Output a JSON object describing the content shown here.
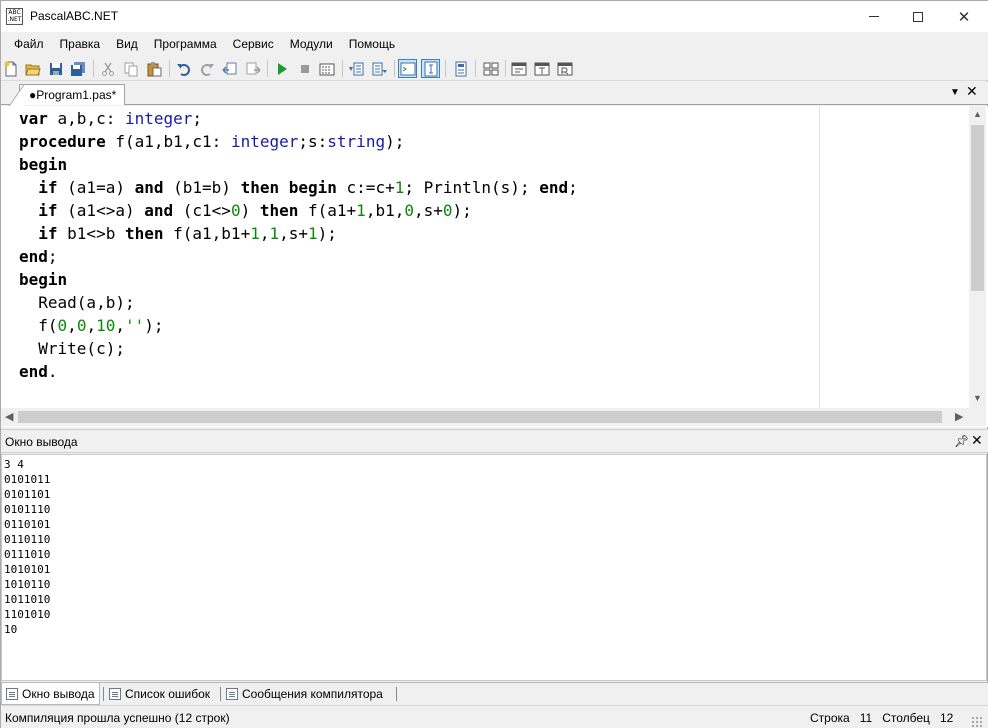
{
  "window": {
    "title": "PascalABC.NET",
    "icon": "pascalabc-app-icon",
    "icon_text": "ABC .NET",
    "controls": [
      "minimize-icon",
      "maximize-icon",
      "close-icon"
    ]
  },
  "menu": [
    "Файл",
    "Правка",
    "Вид",
    "Программа",
    "Сервис",
    "Модули",
    "Помощь"
  ],
  "toolbar": {
    "buttons": [
      {
        "icon": "new-file-icon",
        "color": "#f5f5f5"
      },
      {
        "icon": "open-folder-icon",
        "color": "#e8b84a"
      },
      {
        "icon": "save-icon",
        "color": "#2f5f9a"
      },
      {
        "icon": "save-all-icon",
        "color": "#2f5f9a"
      },
      {
        "icon": "cut-icon",
        "color": "#a0a0a0"
      },
      {
        "icon": "copy-icon",
        "color": "#a0a0a0"
      },
      {
        "icon": "paste-icon",
        "color": "#c8903a"
      },
      {
        "icon": "undo-icon",
        "color": "#2f5f9a"
      },
      {
        "icon": "redo-icon",
        "color": "#a0a0a0"
      },
      {
        "icon": "navigate-back-icon",
        "color": "#5a7fa8"
      },
      {
        "icon": "navigate-forward-icon",
        "color": "#a0a0a0"
      },
      {
        "icon": "run-icon",
        "color": "#1e9a2a"
      },
      {
        "icon": "stop-icon",
        "color": "#9a9a9a"
      },
      {
        "icon": "compile-icon",
        "color": "#555555"
      },
      {
        "icon": "step-into-icon",
        "color": "#3b6ea5"
      },
      {
        "icon": "step-over-icon",
        "color": "#3b6ea5"
      },
      {
        "icon": "output-window-toggle-icon",
        "color": "#3b6ea5",
        "active": true
      },
      {
        "icon": "format-toggle-icon",
        "color": "#3b6ea5",
        "active": true
      },
      {
        "icon": "debug-window-icon",
        "color": "#3b6ea5"
      },
      {
        "icon": "disassembly-icon",
        "color": "#555555"
      },
      {
        "icon": "form-designer-icon",
        "color": "#555555"
      },
      {
        "icon": "text-template-icon",
        "color": "#555555"
      },
      {
        "icon": "refresh-template-icon",
        "color": "#555555"
      }
    ]
  },
  "editor": {
    "tab_label": "●Program1.pas*",
    "tab_dropdown_icon": "chevron-down-icon",
    "tab_close_icon": "close-icon",
    "code_lines": [
      [
        {
          "t": "var",
          "c": "kw"
        },
        {
          "t": " a,b,c: "
        },
        {
          "t": "integer",
          "c": "ty"
        },
        {
          "t": ";"
        }
      ],
      [
        {
          "t": "procedure",
          "c": "kw"
        },
        {
          "t": " f(a1,b1,c1: "
        },
        {
          "t": "integer",
          "c": "ty"
        },
        {
          "t": ";s:"
        },
        {
          "t": "string",
          "c": "ty"
        },
        {
          "t": ");"
        }
      ],
      [
        {
          "t": "begin",
          "c": "kw"
        }
      ],
      [
        {
          "t": "  "
        },
        {
          "t": "if",
          "c": "kw"
        },
        {
          "t": " (a1=a) "
        },
        {
          "t": "and",
          "c": "kw"
        },
        {
          "t": " (b1=b) "
        },
        {
          "t": "then",
          "c": "kw"
        },
        {
          "t": " "
        },
        {
          "t": "begin",
          "c": "kw"
        },
        {
          "t": " c:=c+"
        },
        {
          "t": "1",
          "c": "num"
        },
        {
          "t": "; Println(s); "
        },
        {
          "t": "end",
          "c": "kw"
        },
        {
          "t": ";"
        }
      ],
      [
        {
          "t": "  "
        },
        {
          "t": "if",
          "c": "kw"
        },
        {
          "t": " (a1<>a) "
        },
        {
          "t": "and",
          "c": "kw"
        },
        {
          "t": " (c1<>"
        },
        {
          "t": "0",
          "c": "num"
        },
        {
          "t": ") "
        },
        {
          "t": "then",
          "c": "kw"
        },
        {
          "t": " f(a1+"
        },
        {
          "t": "1",
          "c": "num"
        },
        {
          "t": ",b1,"
        },
        {
          "t": "0",
          "c": "num"
        },
        {
          "t": ",s+"
        },
        {
          "t": "0",
          "c": "num"
        },
        {
          "t": ");"
        }
      ],
      [
        {
          "t": "  "
        },
        {
          "t": "if",
          "c": "kw"
        },
        {
          "t": " b1<>b "
        },
        {
          "t": "then",
          "c": "kw"
        },
        {
          "t": " f(a1,b1+"
        },
        {
          "t": "1",
          "c": "num"
        },
        {
          "t": ","
        },
        {
          "t": "1",
          "c": "num"
        },
        {
          "t": ",s+"
        },
        {
          "t": "1",
          "c": "num"
        },
        {
          "t": ");"
        }
      ],
      [
        {
          "t": "end",
          "c": "kw"
        },
        {
          "t": ";"
        }
      ],
      [
        {
          "t": "begin",
          "c": "kw"
        }
      ],
      [
        {
          "t": "  Read(a,b);"
        }
      ],
      [
        {
          "t": "  f("
        },
        {
          "t": "0",
          "c": "num"
        },
        {
          "t": ","
        },
        {
          "t": "0",
          "c": "num"
        },
        {
          "t": ","
        },
        {
          "t": "10",
          "c": "num"
        },
        {
          "t": ","
        },
        {
          "t": "''",
          "c": "str"
        },
        {
          "t": ");"
        }
      ],
      [
        {
          "t": "  Write(c);"
        }
      ],
      [
        {
          "t": "end",
          "c": "kw"
        },
        {
          "t": "."
        }
      ]
    ]
  },
  "output_pane": {
    "title": "Окно вывода",
    "pin_icon": "pin-icon",
    "close_icon": "close-icon",
    "lines": [
      "3 4",
      "0101011",
      "0101101",
      "0101110",
      "0110101",
      "0110110",
      "0111010",
      "1010101",
      "1010110",
      "1011010",
      "1101010",
      "10"
    ]
  },
  "bottom_tabs": [
    {
      "label": "Окно вывода",
      "icon": "output-window-icon",
      "active": true
    },
    {
      "label": "Список ошибок",
      "icon": "error-list-icon",
      "active": false
    },
    {
      "label": "Сообщения компилятора",
      "icon": "compiler-messages-icon",
      "active": false
    }
  ],
  "status": {
    "message": "Компиляция прошла успешно (12 строк)",
    "line_label": "Строка",
    "line_value": "11",
    "column_label": "Столбец",
    "column_value": "12"
  }
}
